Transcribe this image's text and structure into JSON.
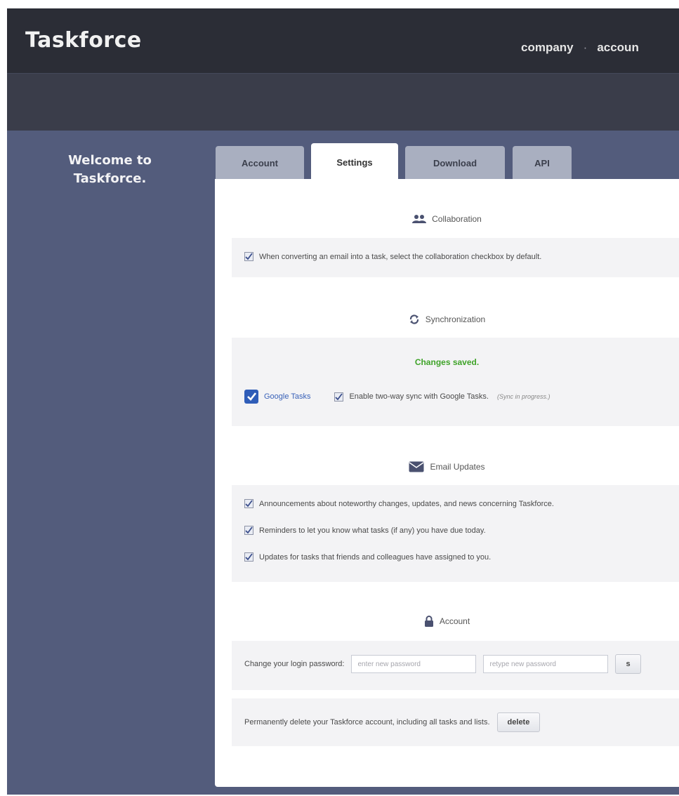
{
  "header": {
    "brand": "Taskforce",
    "nav": [
      "company",
      "accoun"
    ],
    "nav_separator": "·"
  },
  "sidebar": {
    "welcome_line1": "Welcome to",
    "welcome_line2": "Taskforce."
  },
  "tabs": [
    {
      "label": "Account",
      "active": false
    },
    {
      "label": "Settings",
      "active": true
    },
    {
      "label": "Download",
      "active": false
    },
    {
      "label": "API",
      "active": false
    }
  ],
  "collaboration": {
    "title": "Collaboration",
    "icon": "people-icon",
    "option": {
      "label": "When converting an email into a task, select the collaboration checkbox by default.",
      "checked": true
    }
  },
  "synchronization": {
    "title": "Synchronization",
    "icon": "sync-icon",
    "status": "Changes saved.",
    "service_label": "Google Tasks",
    "option": {
      "label": "Enable two-way sync with Google Tasks.",
      "checked": true
    },
    "note": "(Sync in progress.)"
  },
  "email_updates": {
    "title": "Email Updates",
    "icon": "envelope-icon",
    "options": [
      {
        "label": "Announcements about noteworthy changes, updates, and news concerning Taskforce.",
        "checked": true
      },
      {
        "label": "Reminders to let you know what tasks (if any) you have due today.",
        "checked": true
      },
      {
        "label": "Updates for tasks that friends and colleagues have assigned to you.",
        "checked": true
      }
    ]
  },
  "account": {
    "title": "Account",
    "icon": "lock-icon",
    "password_label": "Change your login password:",
    "new_password_placeholder": "enter new password",
    "retype_password_placeholder": "retype new password",
    "save_label": "s",
    "delete_text": "Permanently delete your Taskforce account, including all tasks and lists.",
    "delete_label": "delete"
  },
  "colors": {
    "header_bg": "#2b2d36",
    "sidebar_bg": "#535c7c",
    "status_green": "#3fa329",
    "link_blue": "#3a62b8"
  }
}
